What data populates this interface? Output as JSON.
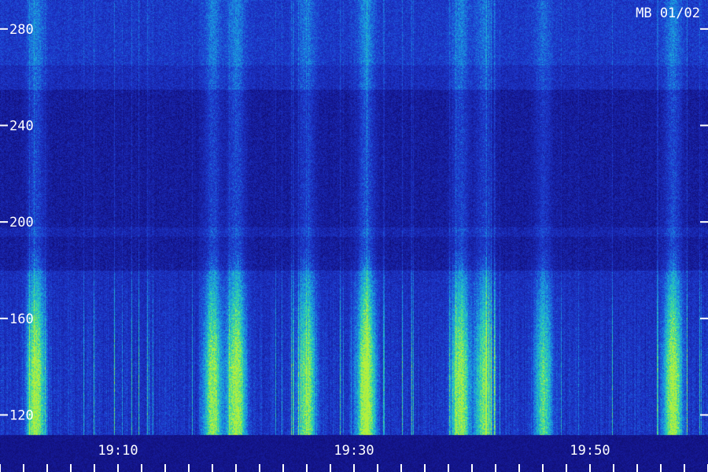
{
  "chart_data": {
    "type": "heatmap",
    "title": "MB 01/02",
    "y_ticks": [
      120,
      160,
      200,
      240,
      280
    ],
    "y_range": [
      112,
      292
    ],
    "x_ticks": [
      "19:10",
      "19:30",
      "19:50"
    ],
    "x_range_minutes": [
      "19:00",
      "20:00"
    ],
    "palette": [
      "#050525",
      "#14148c",
      "#1e3cd2",
      "#19a0e1",
      "#32dca0",
      "#b4f03c"
    ],
    "bursts": [
      {
        "time": "19:03",
        "intensity": 0.85
      },
      {
        "time": "19:18",
        "intensity": 0.8
      },
      {
        "time": "19:20",
        "intensity": 0.9
      },
      {
        "time": "19:26",
        "intensity": 0.75
      },
      {
        "time": "19:31",
        "intensity": 1.0
      },
      {
        "time": "19:39",
        "intensity": 0.85
      },
      {
        "time": "19:41",
        "intensity": 0.7
      },
      {
        "time": "19:46",
        "intensity": 0.6
      },
      {
        "time": "19:57",
        "intensity": 0.9
      }
    ]
  }
}
